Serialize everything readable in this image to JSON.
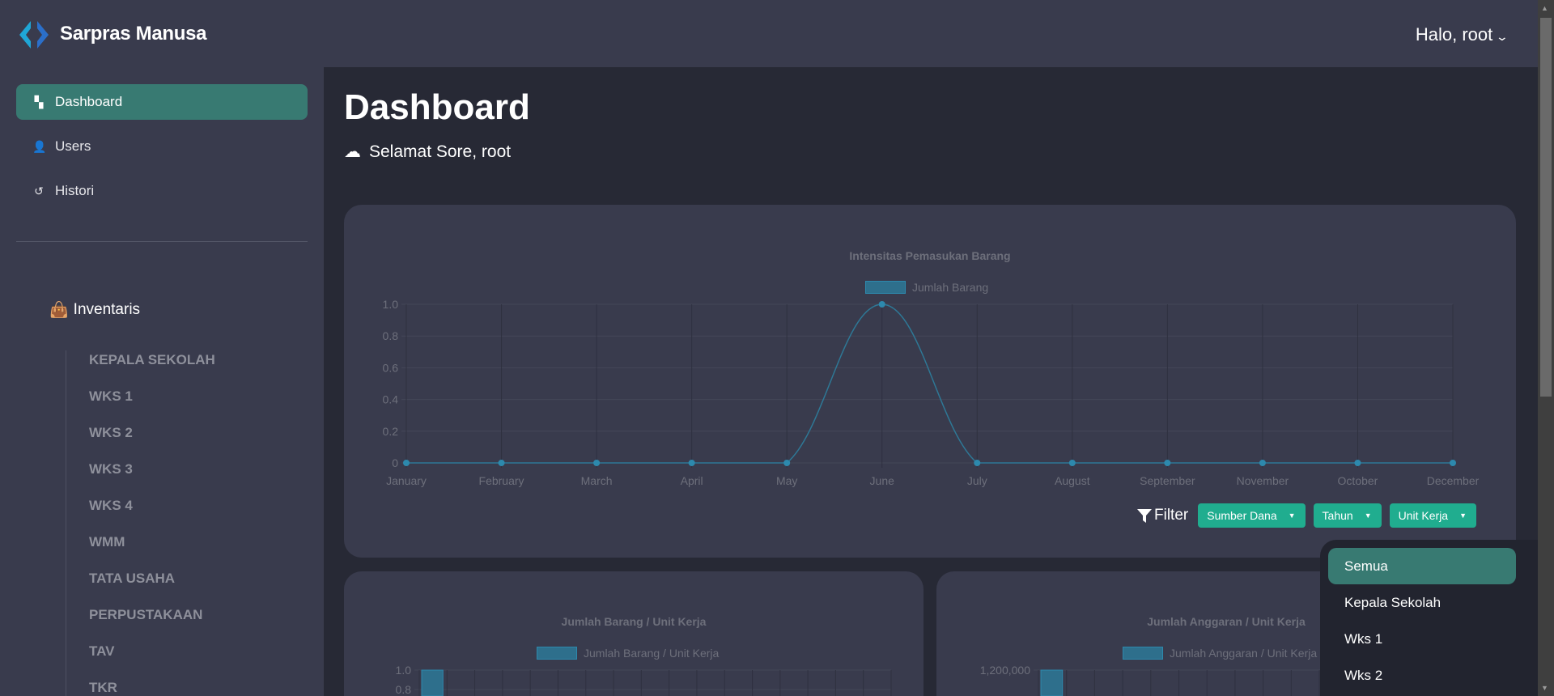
{
  "header": {
    "brand": "Sarpras Manusa",
    "user_greeting": "Halo, root"
  },
  "sidebar": {
    "items": [
      {
        "label": "Dashboard",
        "icon": "dashboard-icon",
        "active": true
      },
      {
        "label": "Users",
        "icon": "user-check-icon"
      },
      {
        "label": "Histori",
        "icon": "history-icon"
      }
    ],
    "section": "Inventaris",
    "sub_items": [
      "KEPALA SEKOLAH",
      "WKS 1",
      "WKS 2",
      "WKS 3",
      "WKS 4",
      "WMM",
      "TATA USAHA",
      "PERPUSTAKAAN",
      "TAV",
      "TKR"
    ]
  },
  "main": {
    "title": "Dashboard",
    "greeting": "Selamat Sore, root"
  },
  "filter": {
    "label": "Filter",
    "buttons": [
      "Sumber Dana",
      "Tahun",
      "Unit Kerja"
    ],
    "dropdown_options": [
      "Semua",
      "Kepala Sekolah",
      "Wks 1",
      "Wks 2"
    ],
    "dropdown_selected": "Semua"
  },
  "colors": {
    "accent": "#387a72",
    "button": "#20ad8f",
    "series": "#2e7896"
  },
  "chart_data": [
    {
      "type": "line",
      "title": "Intensitas Pemasukan Barang",
      "legend": "Jumlah Barang",
      "legend_position": "top",
      "categories": [
        "January",
        "February",
        "March",
        "April",
        "May",
        "June",
        "July",
        "August",
        "September",
        "November",
        "October",
        "December"
      ],
      "values": [
        0,
        0,
        0,
        0,
        0,
        1,
        0,
        0,
        0,
        0,
        0,
        0
      ],
      "yticks": [
        "0",
        "0.2",
        "0.4",
        "0.6",
        "0.8",
        "1.0"
      ],
      "ylim": [
        0,
        1
      ],
      "grid": true
    },
    {
      "type": "bar",
      "title": "Jumlah Barang / Unit Kerja",
      "legend": "Jumlah Barang / Unit Kerja",
      "legend_position": "top",
      "values": [
        1
      ],
      "yticks": [
        "1.0",
        "0.8"
      ],
      "ylim": [
        0,
        1
      ],
      "grid": true
    },
    {
      "type": "bar",
      "title": "Jumlah Anggaran / Unit Kerja",
      "legend": "Jumlah Anggaran / Unit Kerja",
      "legend_position": "top",
      "values": [
        1200000
      ],
      "yticks": [
        "1,200,000"
      ],
      "ylim": [
        0,
        1200000
      ],
      "grid": true
    }
  ]
}
